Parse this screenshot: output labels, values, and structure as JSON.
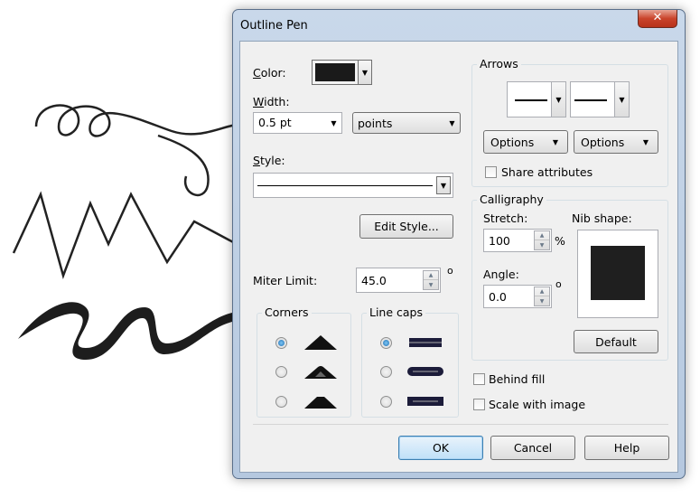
{
  "dialog": {
    "title": "Outline Pen",
    "close_glyph": "✕"
  },
  "color": {
    "label": "Color:",
    "value": "#1a1a1a"
  },
  "width": {
    "label": "Width:",
    "value": "0.5 pt",
    "unit": "points"
  },
  "style": {
    "label": "Style:",
    "edit_button": "Edit Style..."
  },
  "miter": {
    "label": "Miter Limit:",
    "value": "45.0",
    "unit_symbol": "o"
  },
  "corners": {
    "title": "Corners",
    "selected_index": 0
  },
  "line_caps": {
    "title": "Line caps",
    "selected_index": 0
  },
  "arrows": {
    "title": "Arrows",
    "options_left": "Options",
    "options_right": "Options",
    "share_label": "Share attributes"
  },
  "calligraphy": {
    "title": "Calligraphy",
    "stretch_label": "Stretch:",
    "stretch_value": "100",
    "stretch_unit": "%",
    "angle_label": "Angle:",
    "angle_value": "0.0",
    "angle_unit": "o",
    "nib_label": "Nib shape:",
    "default_button": "Default"
  },
  "behind_fill": {
    "label": "Behind fill",
    "checked": false
  },
  "scale_with_image": {
    "label": "Scale with image",
    "checked": false
  },
  "footer": {
    "ok": "OK",
    "cancel": "Cancel",
    "help": "Help"
  },
  "colors": {
    "frame": "#b9cbe0",
    "accent": "#3c7fb1",
    "nib": "#1f1f1f"
  }
}
